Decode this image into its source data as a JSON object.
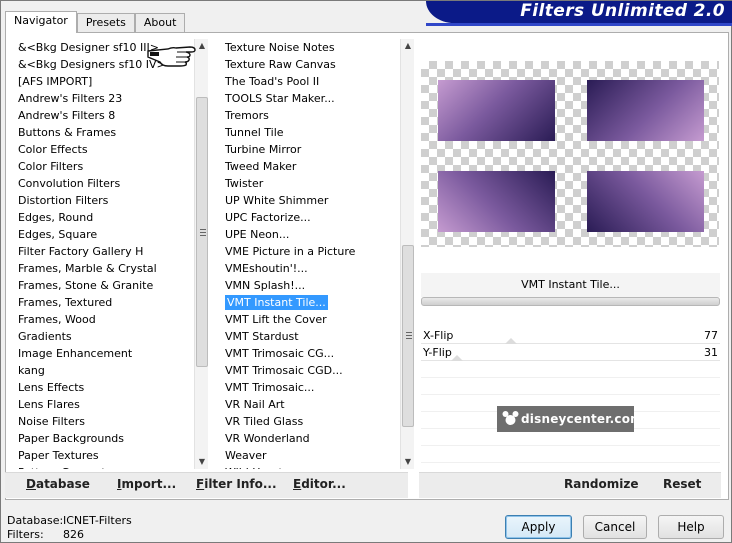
{
  "app": {
    "title": "Filters Unlimited 2.0"
  },
  "tabs": [
    {
      "label": "Navigator",
      "active": true
    },
    {
      "label": "Presets",
      "active": false
    },
    {
      "label": "About",
      "active": false
    }
  ],
  "categories": [
    "&<Bkg Designer sf10 III>",
    "&<Bkg Designers sf10 IV>",
    "[AFS IMPORT]",
    "Andrew's Filters 23",
    "Andrew's Filters 8",
    "Buttons & Frames",
    "Color Effects",
    "Color Filters",
    "Convolution Filters",
    "Distortion Filters",
    "Edges, Round",
    "Edges, Square",
    "Filter Factory Gallery H",
    "Frames, Marble & Crystal",
    "Frames, Stone & Granite",
    "Frames, Textured",
    "Frames, Wood",
    "Gradients",
    "Image Enhancement",
    "kang",
    "Lens Effects",
    "Lens Flares",
    "Noise Filters",
    "Paper Backgrounds",
    "Paper Textures",
    "Pattern Generators"
  ],
  "filters": [
    {
      "label": "Texture Noise Notes"
    },
    {
      "label": "Texture Raw Canvas"
    },
    {
      "label": "The Toad's Pool II"
    },
    {
      "label": "TOOLS Star Maker..."
    },
    {
      "label": "Tremors"
    },
    {
      "label": "Tunnel Tile"
    },
    {
      "label": "Turbine Mirror"
    },
    {
      "label": "Tweed Maker"
    },
    {
      "label": "Twister"
    },
    {
      "label": "UP White Shimmer"
    },
    {
      "label": "UPC Factorize..."
    },
    {
      "label": "UPE Neon..."
    },
    {
      "label": "VME Picture in a Picture"
    },
    {
      "label": "VMEshoutin'!..."
    },
    {
      "label": "VMN Splash!..."
    },
    {
      "label": "VMT Instant Tile...",
      "selected": true
    },
    {
      "label": "VMT Lift the Cover"
    },
    {
      "label": "VMT Stardust"
    },
    {
      "label": "VMT Trimosaic CG..."
    },
    {
      "label": "VMT Trimosaic CGD...",
      "handle": true
    },
    {
      "label": "VMT Trimosaic...",
      "handle": true
    },
    {
      "label": "VR Nail Art"
    },
    {
      "label": "VR Tiled Glass"
    },
    {
      "label": "VR Wonderland"
    },
    {
      "label": "Weaver"
    },
    {
      "label": "Wild Hearts"
    }
  ],
  "preview": {
    "filter_name": "VMT Instant Tile..."
  },
  "params": [
    {
      "name": "X-Flip",
      "value": "77",
      "level": 0.3
    },
    {
      "name": "Y-Flip",
      "value": "31",
      "level": 0.12
    }
  ],
  "watermark": "disneycenter.com",
  "left_buttons": [
    {
      "key": "D",
      "rest": "atabase"
    },
    {
      "key": "I",
      "rest": "mport..."
    },
    {
      "key": "F",
      "rest": "ilter Info..."
    },
    {
      "key": "E",
      "rest": "ditor..."
    }
  ],
  "right_buttons": {
    "randomize": "Randomize",
    "reset": "Reset"
  },
  "status": {
    "database_label": "Database:",
    "database_value": "ICNET-Filters",
    "filters_label": "Filters:",
    "filters_value": "826"
  },
  "dialog_buttons": {
    "apply": "Apply",
    "cancel": "Cancel",
    "help": "Help"
  },
  "colors": {
    "accent_blue": "#0b1a88",
    "selection": "#3399ff"
  }
}
